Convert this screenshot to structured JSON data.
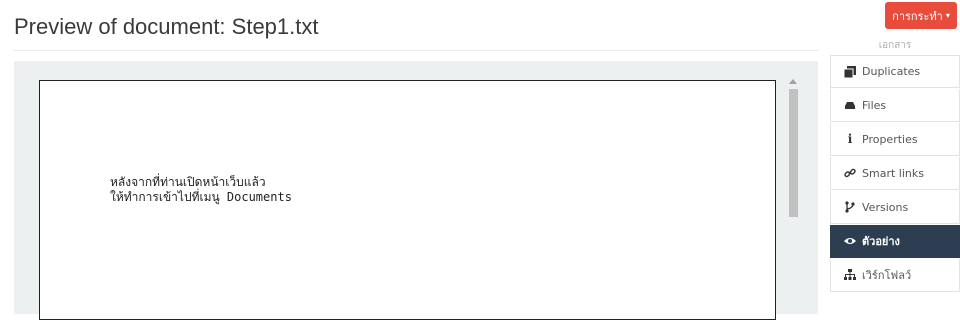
{
  "page": {
    "title": "Preview of document: Step1.txt"
  },
  "actions": {
    "label": "การกระทำ",
    "caret": "▾"
  },
  "sidebar": {
    "header": "เอกสาร",
    "items": [
      {
        "label": "Duplicates",
        "icon": "duplicates-icon"
      },
      {
        "label": "Files",
        "icon": "files-icon"
      },
      {
        "label": "Properties",
        "icon": "info-icon"
      },
      {
        "label": "Smart links",
        "icon": "link-icon"
      },
      {
        "label": "Versions",
        "icon": "versions-icon"
      },
      {
        "label": "ตัวอย่าง",
        "icon": "eye-icon",
        "active": true
      },
      {
        "label": "เวิร์กโฟลว์",
        "icon": "sitemap-icon"
      }
    ]
  },
  "document": {
    "lines": [
      "หลังจากที่ท่านเปิดหน้าเว็บแล้ว",
      "ให้ทำการเข้าไปที่เมนู Documents"
    ]
  }
}
